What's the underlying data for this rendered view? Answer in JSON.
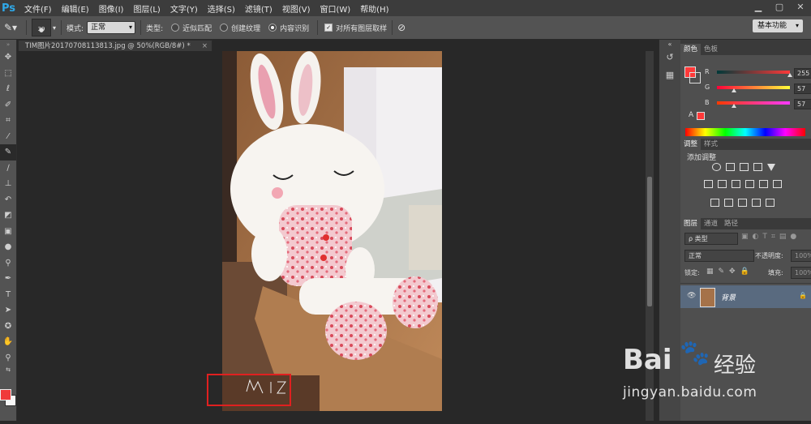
{
  "app": {
    "logo": "Ps"
  },
  "menu": [
    "文件(F)",
    "编辑(E)",
    "图像(I)",
    "图层(L)",
    "文字(Y)",
    "选择(S)",
    "滤镜(T)",
    "视图(V)",
    "窗口(W)",
    "帮助(H)"
  ],
  "window_controls": {
    "min": "▁",
    "max": "▢",
    "close": "✕"
  },
  "options": {
    "brush_size": "39",
    "mode_label": "模式:",
    "mode_value": "正常",
    "type_label": "类型:",
    "type_options": [
      "近似匹配",
      "创建纹理",
      "内容识别"
    ],
    "type_selected": "内容识别",
    "sample_all_label": "对所有图层取样",
    "workspace": "基本功能"
  },
  "document": {
    "tab_title": "TIM图片20170708113813.jpg @ 50%(RGB/8#) *",
    "close": "×"
  },
  "color_panel": {
    "tabs": [
      "颜色",
      "色板"
    ],
    "active_tab": "颜色",
    "r_label": "R",
    "g_label": "G",
    "b_label": "B",
    "r_value": "255",
    "g_value": "57",
    "b_value": "57",
    "foreground_color": "#ff3939"
  },
  "adjust_panel": {
    "tabs": [
      "调整",
      "样式"
    ],
    "active_tab": "调整",
    "title": "添加调整"
  },
  "layers_panel": {
    "tabs": [
      "图层",
      "通道",
      "路径"
    ],
    "active_tab": "图层",
    "filter_label": "ρ 类型",
    "blend_mode": "正常",
    "opacity_label": "不透明度:",
    "opacity_value": "100%",
    "lock_label": "锁定:",
    "fill_label": "填充:",
    "fill_value": "100%",
    "layers": [
      {
        "name": "背景",
        "visible": true,
        "locked": true
      }
    ]
  },
  "watermark": {
    "brand": "Bai",
    "brand2": "经验",
    "url": "jingyan.baidu.com"
  },
  "photo_annotation": {
    "highlight_color": "#e02020"
  }
}
